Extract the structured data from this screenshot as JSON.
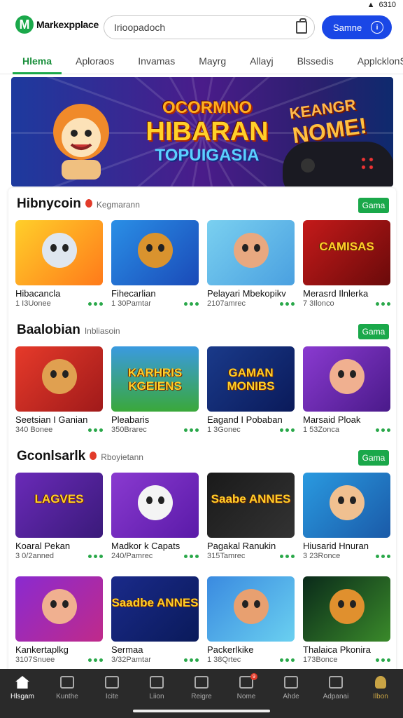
{
  "status": {
    "time": "6310"
  },
  "header": {
    "logo_mark": "M",
    "logo_text": "Markexpplace",
    "search_placeholder": "Irioopadoch",
    "signin_label": "Samne",
    "signin_icon": "i"
  },
  "tabs": [
    {
      "label": "Hlema",
      "active": true
    },
    {
      "label": "Aploraos"
    },
    {
      "label": "Invamas"
    },
    {
      "label": "Mayrg"
    },
    {
      "label": "Allayj"
    },
    {
      "label": "Blssedis"
    },
    {
      "label": "ApplcklonS"
    }
  ],
  "banner": {
    "line1": "OCORMNO",
    "line2": "HIBARAN",
    "line3": "TOPUIGASIA",
    "right1": "KEANGR",
    "right2": "NOME!"
  },
  "sections": [
    {
      "title": "Hibnycoin",
      "subtitle": "Kegmarann",
      "has_dot": true,
      "more_label": "Gama",
      "cards": [
        {
          "name": "Hibacancla",
          "meta": "1 I3Uonee",
          "thumb_text": "",
          "bg": "linear-gradient(135deg,#ffcf2a,#ff7a1a)",
          "face": "#dfe6ef"
        },
        {
          "name": "Fihecarlian",
          "meta": "1 30Pamtar",
          "thumb_text": "",
          "bg": "linear-gradient(135deg,#2a8fe6,#1a4ab8)",
          "face": "#d9932e"
        },
        {
          "name": "Pelayari Mbekopikv",
          "meta": "2107amrec",
          "thumb_text": "",
          "bg": "linear-gradient(135deg,#7ad0f0,#4aa0e0)",
          "face": "#e8a880"
        },
        {
          "name": "Merasrd Ilnlerka",
          "meta": "7 3Ilonco",
          "thumb_text": "CAMISAS",
          "bg": "linear-gradient(135deg,#c41a1a,#6a0a0a)",
          "face": ""
        }
      ]
    },
    {
      "title": "Baalobian",
      "subtitle": "Inbliasoin",
      "has_dot": false,
      "more_label": "Gama",
      "cards": [
        {
          "name": "Seetsian I Ganian",
          "meta": "340 Bonee",
          "thumb_text": "",
          "bg": "linear-gradient(135deg,#e63a2a,#a01a1a)",
          "face": "#e0a050"
        },
        {
          "name": "Pleabaris",
          "meta": "350Brarec",
          "thumb_text": "KARHRIS KGEIENS",
          "bg": "linear-gradient(180deg,#3a9ae0,#3aa83a)",
          "face": ""
        },
        {
          "name": "Eagand I Pobaban",
          "meta": "1 3Gonec",
          "thumb_text": "GAMAN MONIBS",
          "bg": "linear-gradient(135deg,#1a3a8a,#0a1a5a)",
          "face": ""
        },
        {
          "name": "Marsaid Ploak",
          "meta": "1 53Zonca",
          "thumb_text": "",
          "bg": "linear-gradient(135deg,#8a3ad0,#4a1a8a)",
          "face": "#f0b090"
        }
      ]
    },
    {
      "title": "Gconlsarlk",
      "subtitle": "Rboyietann",
      "has_dot": true,
      "more_label": "Gama",
      "cards": [
        {
          "name": "Koaral Pekan",
          "meta": "3 0/2anned",
          "thumb_text": "LAGVES",
          "bg": "linear-gradient(135deg,#6a2ab8,#3a1a7a)",
          "face": ""
        },
        {
          "name": "Madkor k Capats",
          "meta": "240/Pamrec",
          "thumb_text": "",
          "bg": "linear-gradient(135deg,#8a3ad0,#5a1aa8)",
          "face": "#f4f4f4"
        },
        {
          "name": "Pagakal Ranukin",
          "meta": "315Tamrec",
          "thumb_text": "Saabe ANNES",
          "bg": "linear-gradient(135deg,#1a1a1a,#333)",
          "face": ""
        },
        {
          "name": "Hiusarid Hnuran",
          "meta": "3 23Ronce",
          "thumb_text": "",
          "bg": "linear-gradient(135deg,#2a9ae0,#1a5aa8)",
          "face": "#f0c090"
        }
      ]
    },
    {
      "title": "",
      "subtitle": "",
      "has_dot": false,
      "more_label": "",
      "cards": [
        {
          "name": "Kankertaplkg",
          "meta": "3107Snuee",
          "thumb_text": "",
          "bg": "linear-gradient(135deg,#8a2ad0,#c02a8a)",
          "face": "#f0b090"
        },
        {
          "name": "Sermaa",
          "meta": "3/32Pamtar",
          "thumb_text": "Saadbe ANNES",
          "bg": "linear-gradient(135deg,#1a2a8a,#0a1a5a)",
          "face": ""
        },
        {
          "name": "Packerlkike",
          "meta": "1 38Qrtec",
          "thumb_text": "",
          "bg": "linear-gradient(135deg,#3a8ae0,#6ad0f0)",
          "face": "#e8a070"
        },
        {
          "name": "Thalaica Pkonira",
          "meta": "173Bonce",
          "thumb_text": "",
          "bg": "linear-gradient(135deg,#0a2a1a,#3a8a2a)",
          "face": "#e0902e"
        }
      ]
    }
  ],
  "nav": [
    {
      "label": "Hlsgam",
      "icon": "home-icon",
      "active": true
    },
    {
      "label": "Kunthe",
      "icon": "cube-icon"
    },
    {
      "label": "Icite",
      "icon": "list-icon"
    },
    {
      "label": "Liion",
      "icon": "star-icon"
    },
    {
      "label": "Reigre",
      "icon": "globe-icon"
    },
    {
      "label": "Nome",
      "icon": "chat-icon",
      "badge": "9"
    },
    {
      "label": "Ahde",
      "icon": "bolt-icon"
    },
    {
      "label": "Adpanai",
      "icon": "mail-icon"
    },
    {
      "label": "Ilbon",
      "icon": "user-icon",
      "gold": true
    }
  ]
}
